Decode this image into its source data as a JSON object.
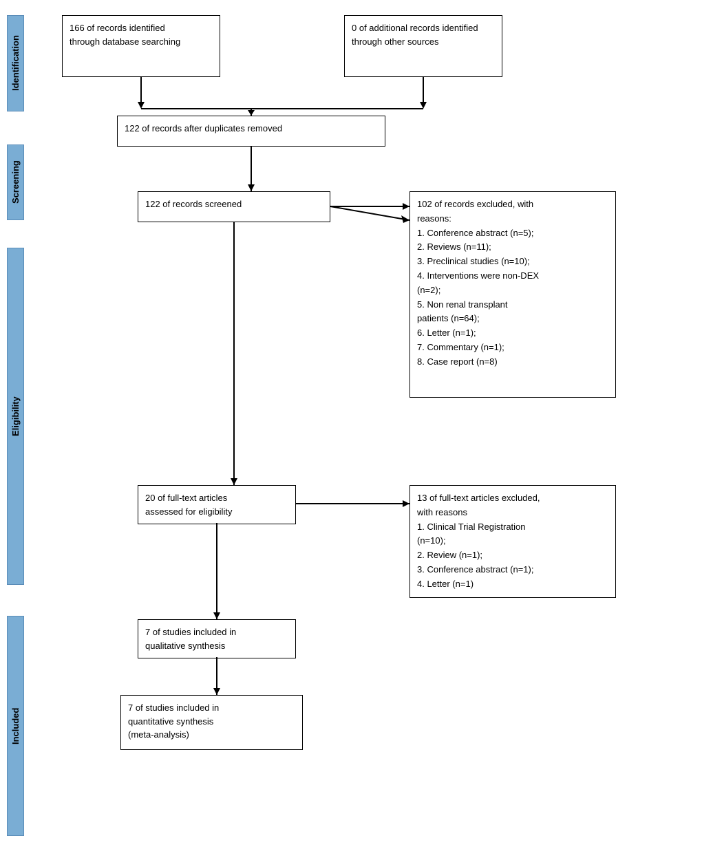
{
  "labels": {
    "identification": "Identification",
    "screening": "Screening",
    "eligibility": "Eligibility",
    "included": "Included"
  },
  "boxes": {
    "db_records": "166  of  records  identified\nthrough database searching",
    "other_records": "0  of additional records identified\nthrough other sources",
    "after_duplicates": "122  of records after duplicates removed",
    "screened": "122  of records screened",
    "excluded": "102 of records excluded,    with\nreasons:\n1.  Conference abstract (n=5);\n2.  Reviews (n=11);\n3.  Preclinical studies (n=10);\n4.  Interventions were non-DEX\n     (n=2);\n5.  Non   renal   transplant\n     patients (n=64);\n6.  Letter (n=1);\n7.  Commentary (n=1);\n8.  Case report (n=8)",
    "fulltext": "20  of  full-text  articles\nassessed for eligibility",
    "fulltext_excluded": "13 of full-text articles excluded,\nwith reasons\n1.  Clinical   Trial   Registration\n     (n=10);\n2.  Review (n=1);\n3.  Conference abstract (n=1);\n4.  Letter (n=1)",
    "qualitative": "7  of  studies  included  in\nqualitative synthesis",
    "quantitative": "7  of  studies  included  in\nquantitative    synthesis\n(meta-analysis)"
  }
}
